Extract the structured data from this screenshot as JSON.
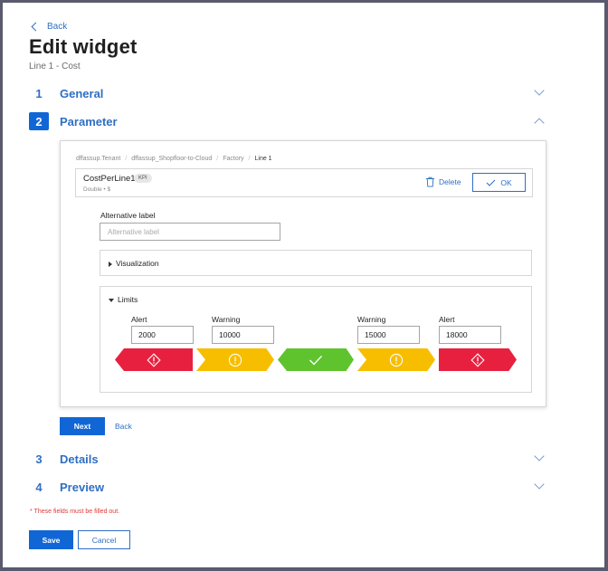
{
  "nav": {
    "back_label": "Back"
  },
  "header": {
    "title": "Edit widget",
    "subtitle": "Line 1 - Cost"
  },
  "steps": [
    {
      "number": "1",
      "label": "General",
      "expanded": false
    },
    {
      "number": "2",
      "label": "Parameter",
      "expanded": true
    },
    {
      "number": "3",
      "label": "Details",
      "expanded": false
    },
    {
      "number": "4",
      "label": "Preview",
      "expanded": false
    }
  ],
  "parameter": {
    "breadcrumb": [
      "dffassup.Tenant",
      "dffassup_Shopfloor-to-Cloud",
      "Factory",
      "Line 1"
    ],
    "kpi": {
      "name": "CostPerLine1",
      "badge": "KPI",
      "meta": "Double • $",
      "delete_label": "Delete",
      "ok_label": "OK"
    },
    "alternative_label": {
      "label": "Alternative label",
      "placeholder": "Alternative label",
      "value": ""
    },
    "visualization": {
      "title": "Visualization",
      "expanded": false
    },
    "limits": {
      "title": "Limits",
      "expanded": true,
      "fields": [
        {
          "label": "Alert",
          "value": "2000"
        },
        {
          "label": "Warning",
          "value": "10000"
        },
        {
          "label": "Warning",
          "value": "15000"
        },
        {
          "label": "Alert",
          "value": "18000"
        }
      ],
      "zones": [
        {
          "kind": "alert",
          "icon": "alert-diamond-icon"
        },
        {
          "kind": "warning",
          "icon": "warning-circle-icon"
        },
        {
          "kind": "ok",
          "icon": "checkmark-icon"
        },
        {
          "kind": "warning",
          "icon": "warning-circle-icon"
        },
        {
          "kind": "alert",
          "icon": "alert-diamond-icon"
        }
      ]
    },
    "next_label": "Next",
    "back_label": "Back"
  },
  "footer": {
    "required_note": "* These fields must be filled out.",
    "save_label": "Save",
    "cancel_label": "Cancel"
  },
  "colors": {
    "primary": "#1166d6",
    "link": "#2f6fc4",
    "alert": "#e8203f",
    "warning": "#f7be00",
    "ok": "#5fc32d",
    "required": "#e03a3a"
  }
}
